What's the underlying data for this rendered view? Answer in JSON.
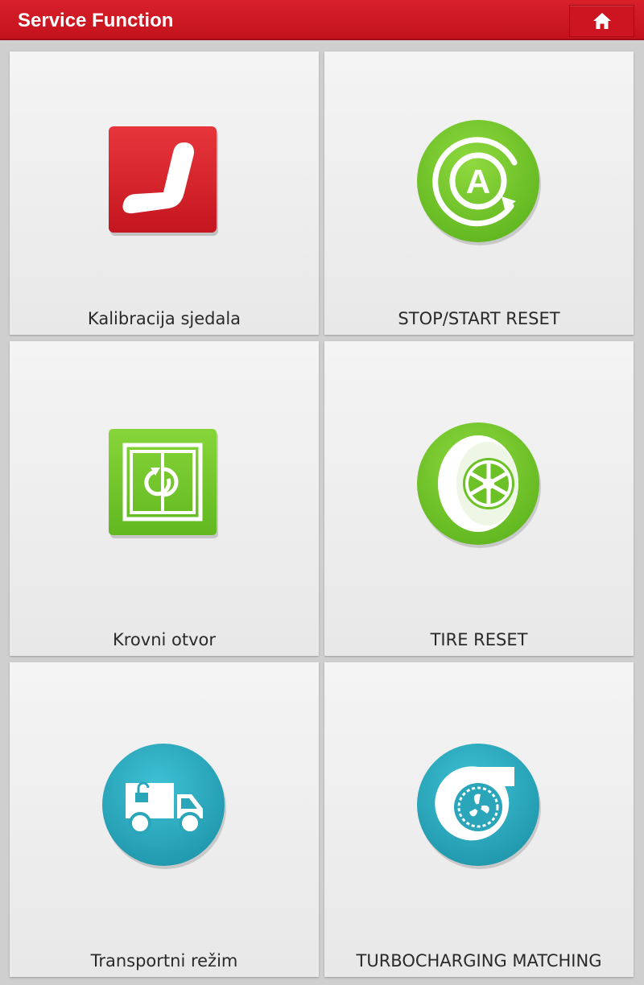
{
  "header": {
    "title": "Service Function",
    "home_icon": "home-icon"
  },
  "colors": {
    "header_red": "#d31b26",
    "icon_red": "#d8262f",
    "icon_green": "#72c72a",
    "icon_teal": "#2ba8bd",
    "tile_background": "#eeeeee",
    "page_background": "#cfcfcf"
  },
  "tiles": [
    {
      "label": "Kalibracija sjedala",
      "icon": "seat-icon"
    },
    {
      "label": "STOP/START RESET",
      "icon": "auto-start-stop-icon"
    },
    {
      "label": "Krovni otvor",
      "icon": "sunroof-icon"
    },
    {
      "label": "TIRE RESET",
      "icon": "tire-icon"
    },
    {
      "label": "Transportni režim",
      "icon": "transport-truck-icon"
    },
    {
      "label": "TURBOCHARGING MATCHING",
      "icon": "turbocharger-icon"
    }
  ]
}
